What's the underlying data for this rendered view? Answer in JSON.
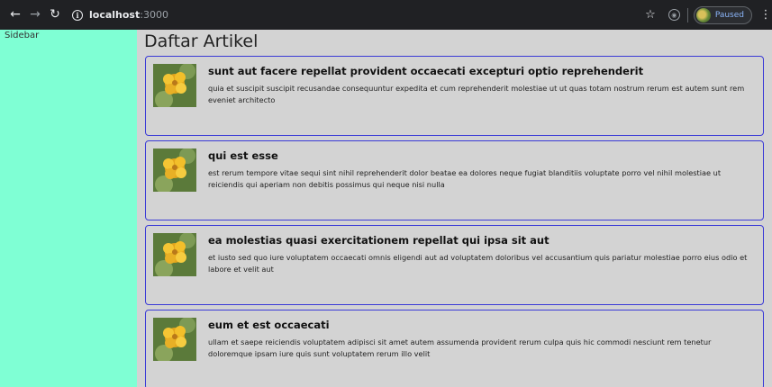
{
  "browser": {
    "back_icon": "arrow-left",
    "forward_icon": "arrow-right",
    "reload_icon": "reload",
    "url_host": "localhost",
    "url_port": ":3000",
    "profile_status": "Paused",
    "accent": "#8ab4f8"
  },
  "sidebar": {
    "label": "Sidebar",
    "background": "#7fffd4"
  },
  "main": {
    "title": "Daftar Artikel",
    "articles": [
      {
        "title": "sunt aut facere repellat provident occaecati excepturi optio reprehenderit",
        "body": "quia et suscipit suscipit recusandae consequuntur expedita et cum reprehenderit molestiae ut ut quas totam nostrum rerum est autem sunt rem eveniet architecto"
      },
      {
        "title": "qui est esse",
        "body": "est rerum tempore vitae sequi sint nihil reprehenderit dolor beatae ea dolores neque fugiat blanditiis voluptate porro vel nihil molestiae ut reiciendis qui aperiam non debitis possimus qui neque nisi nulla"
      },
      {
        "title": "ea molestias quasi exercitationem repellat qui ipsa sit aut",
        "body": "et iusto sed quo iure voluptatem occaecati omnis eligendi aut ad voluptatem doloribus vel accusantium quis pariatur molestiae porro eius odio et labore et velit aut"
      },
      {
        "title": "eum et est occaecati",
        "body": "ullam et saepe reiciendis voluptatem adipisci sit amet autem assumenda provident rerum culpa quis hic commodi nesciunt rem tenetur doloremque ipsam iure quis sunt voluptatem rerum illo velit"
      }
    ],
    "card_border_color": "#3a3ad6"
  }
}
